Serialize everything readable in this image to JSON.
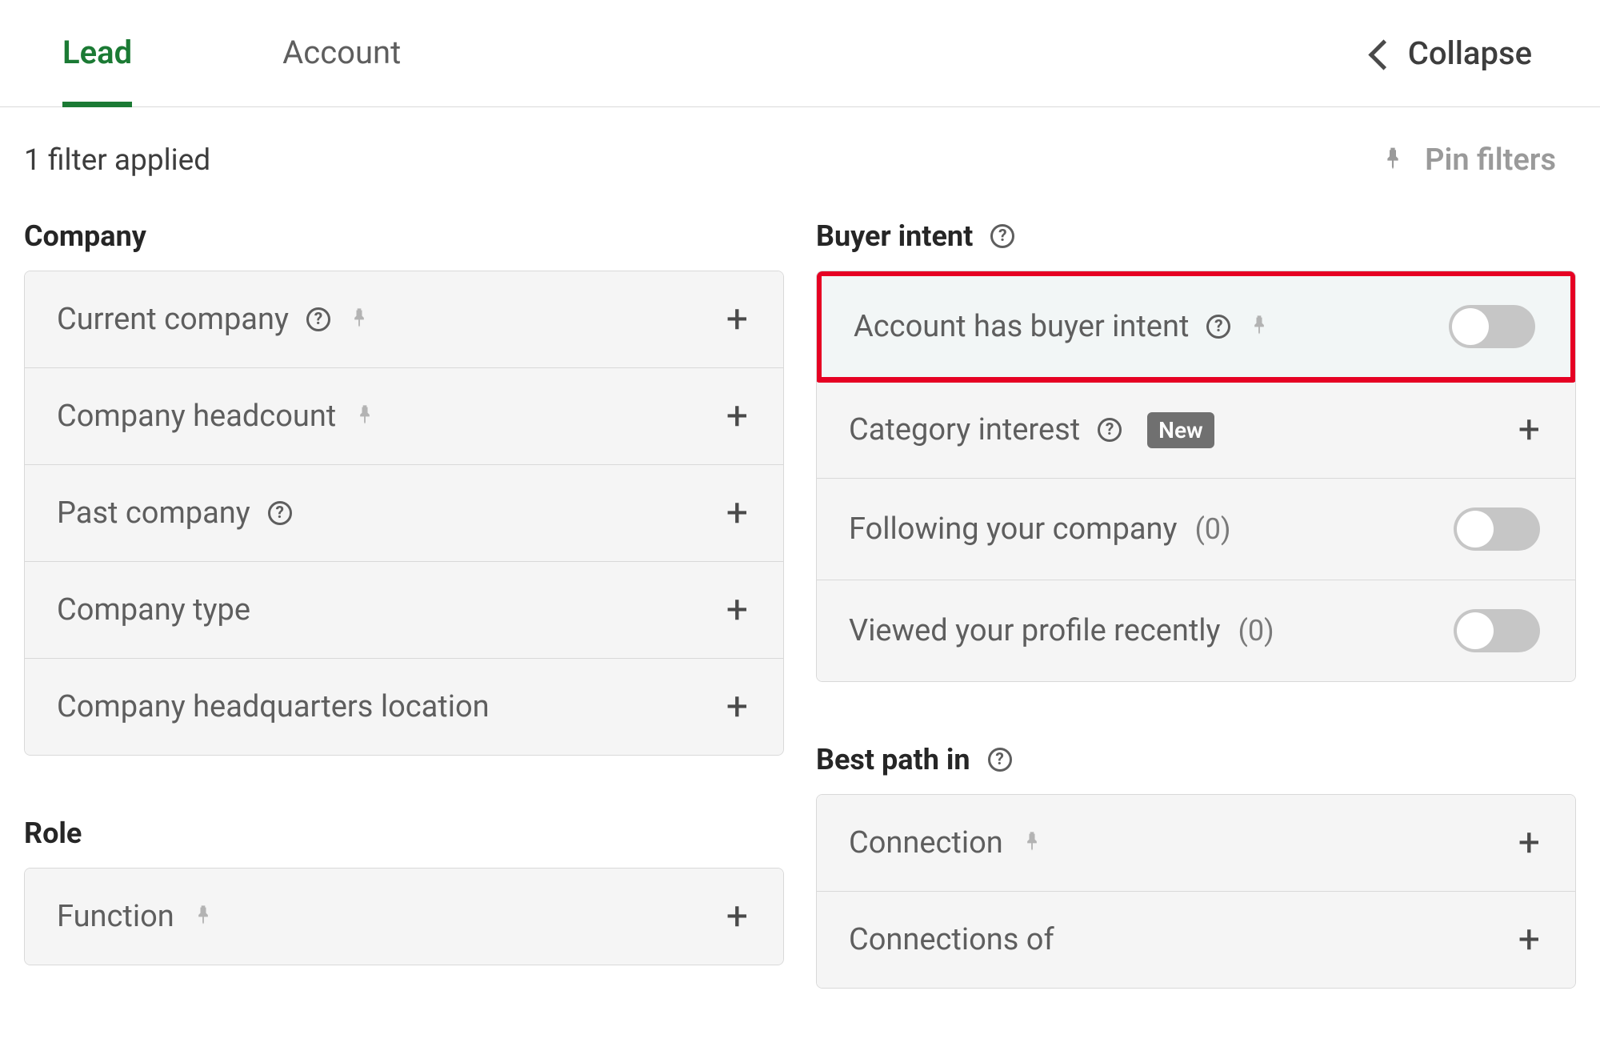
{
  "tabs": {
    "lead": "Lead",
    "account": "Account"
  },
  "collapse_label": "Collapse",
  "filter_count_text": "1 filter applied",
  "pin_filters_label": "Pin filters",
  "sections": {
    "company": {
      "title": "Company",
      "items": {
        "current_company": "Current company",
        "company_headcount": "Company headcount",
        "past_company": "Past company",
        "company_type": "Company type",
        "company_hq_location": "Company headquarters location"
      }
    },
    "role": {
      "title": "Role",
      "items": {
        "function": "Function"
      }
    },
    "buyer_intent": {
      "title": "Buyer intent",
      "items": {
        "account_has_buyer_intent": "Account has buyer intent",
        "category_interest": "Category interest",
        "category_interest_badge": "New",
        "following_your_company": "Following your company",
        "following_your_company_count": "(0)",
        "viewed_profile_recently": "Viewed your profile recently",
        "viewed_profile_recently_count": "(0)"
      }
    },
    "best_path_in": {
      "title": "Best path in",
      "items": {
        "connection": "Connection",
        "connections_of": "Connections of"
      }
    }
  }
}
